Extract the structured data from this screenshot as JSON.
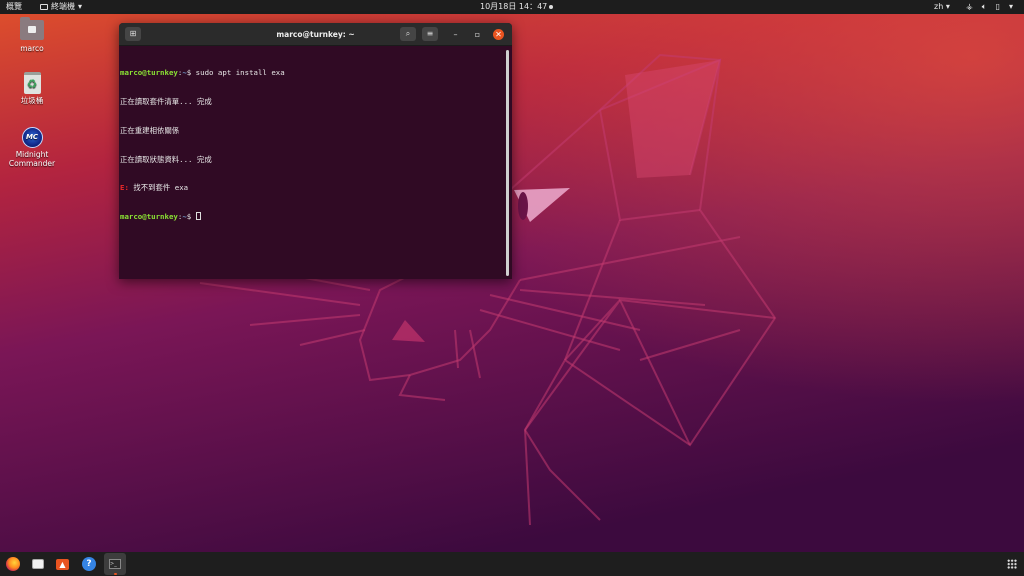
{
  "topbar": {
    "activities": "概覽",
    "app_menu": "終端機",
    "clock": "10月18日  14：47",
    "language": "zh ▾",
    "tray_icons": [
      "network-icon",
      "volume-icon",
      "battery-icon",
      "power-menu-icon"
    ]
  },
  "desktop": {
    "icons": [
      {
        "label": "marco",
        "icon": "home-folder-icon"
      },
      {
        "label": "垃圾桶",
        "icon": "trash-icon"
      },
      {
        "label": "Midnight\nCommander",
        "icon": "midnight-commander-icon"
      }
    ]
  },
  "terminal": {
    "title": "marco@turnkey: ~",
    "lines": [
      {
        "user": "marco@turnkey",
        "sep": ":",
        "path": "~",
        "prompt": "$ ",
        "cmd": "sudo apt install exa"
      },
      {
        "text": "正在讀取套件清單... 完成"
      },
      {
        "text": "正在重建相依關係"
      },
      {
        "text": "正在讀取狀態資料... 完成"
      },
      {
        "error_tag": "E:",
        "text": " 找不到套件 exa"
      },
      {
        "user": "marco@turnkey",
        "sep": ":",
        "path": "~",
        "prompt": "$ ",
        "cmd": ""
      }
    ]
  },
  "dock": {
    "items": [
      "Firefox",
      "Files",
      "Ubuntu Software",
      "Help",
      "Terminal",
      "Show Applications"
    ],
    "active": "Terminal"
  },
  "colors": {
    "accent": "#e95420",
    "terminal_bg": "#300a24",
    "prompt_user": "#8ae234",
    "prompt_path": "#729fcf"
  }
}
